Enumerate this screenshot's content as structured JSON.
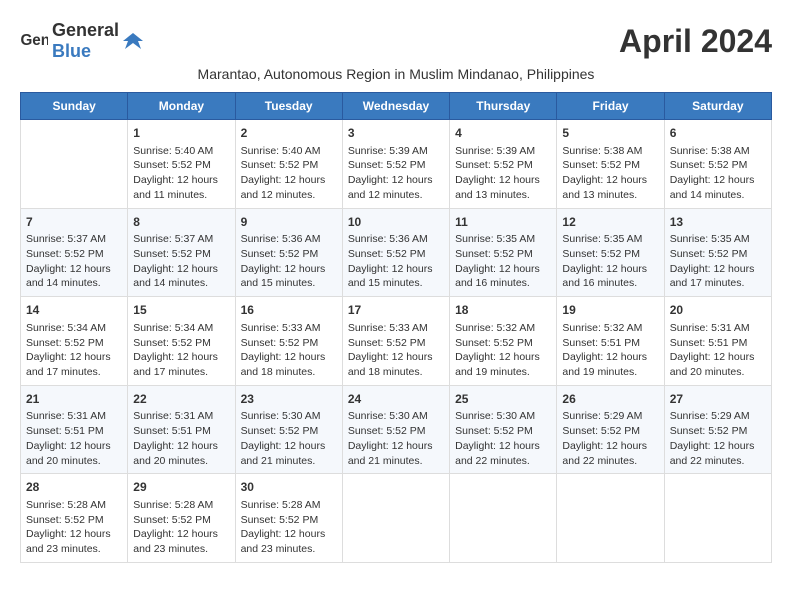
{
  "logo": {
    "text_general": "General",
    "text_blue": "Blue"
  },
  "title": "April 2024",
  "subtitle": "Marantao, Autonomous Region in Muslim Mindanao, Philippines",
  "days_of_week": [
    "Sunday",
    "Monday",
    "Tuesday",
    "Wednesday",
    "Thursday",
    "Friday",
    "Saturday"
  ],
  "weeks": [
    [
      {
        "day": "",
        "info": ""
      },
      {
        "day": "1",
        "info": "Sunrise: 5:40 AM\nSunset: 5:52 PM\nDaylight: 12 hours\nand 11 minutes."
      },
      {
        "day": "2",
        "info": "Sunrise: 5:40 AM\nSunset: 5:52 PM\nDaylight: 12 hours\nand 12 minutes."
      },
      {
        "day": "3",
        "info": "Sunrise: 5:39 AM\nSunset: 5:52 PM\nDaylight: 12 hours\nand 12 minutes."
      },
      {
        "day": "4",
        "info": "Sunrise: 5:39 AM\nSunset: 5:52 PM\nDaylight: 12 hours\nand 13 minutes."
      },
      {
        "day": "5",
        "info": "Sunrise: 5:38 AM\nSunset: 5:52 PM\nDaylight: 12 hours\nand 13 minutes."
      },
      {
        "day": "6",
        "info": "Sunrise: 5:38 AM\nSunset: 5:52 PM\nDaylight: 12 hours\nand 14 minutes."
      }
    ],
    [
      {
        "day": "7",
        "info": "Sunrise: 5:37 AM\nSunset: 5:52 PM\nDaylight: 12 hours\nand 14 minutes."
      },
      {
        "day": "8",
        "info": "Sunrise: 5:37 AM\nSunset: 5:52 PM\nDaylight: 12 hours\nand 14 minutes."
      },
      {
        "day": "9",
        "info": "Sunrise: 5:36 AM\nSunset: 5:52 PM\nDaylight: 12 hours\nand 15 minutes."
      },
      {
        "day": "10",
        "info": "Sunrise: 5:36 AM\nSunset: 5:52 PM\nDaylight: 12 hours\nand 15 minutes."
      },
      {
        "day": "11",
        "info": "Sunrise: 5:35 AM\nSunset: 5:52 PM\nDaylight: 12 hours\nand 16 minutes."
      },
      {
        "day": "12",
        "info": "Sunrise: 5:35 AM\nSunset: 5:52 PM\nDaylight: 12 hours\nand 16 minutes."
      },
      {
        "day": "13",
        "info": "Sunrise: 5:35 AM\nSunset: 5:52 PM\nDaylight: 12 hours\nand 17 minutes."
      }
    ],
    [
      {
        "day": "14",
        "info": "Sunrise: 5:34 AM\nSunset: 5:52 PM\nDaylight: 12 hours\nand 17 minutes."
      },
      {
        "day": "15",
        "info": "Sunrise: 5:34 AM\nSunset: 5:52 PM\nDaylight: 12 hours\nand 17 minutes."
      },
      {
        "day": "16",
        "info": "Sunrise: 5:33 AM\nSunset: 5:52 PM\nDaylight: 12 hours\nand 18 minutes."
      },
      {
        "day": "17",
        "info": "Sunrise: 5:33 AM\nSunset: 5:52 PM\nDaylight: 12 hours\nand 18 minutes."
      },
      {
        "day": "18",
        "info": "Sunrise: 5:32 AM\nSunset: 5:52 PM\nDaylight: 12 hours\nand 19 minutes."
      },
      {
        "day": "19",
        "info": "Sunrise: 5:32 AM\nSunset: 5:51 PM\nDaylight: 12 hours\nand 19 minutes."
      },
      {
        "day": "20",
        "info": "Sunrise: 5:31 AM\nSunset: 5:51 PM\nDaylight: 12 hours\nand 20 minutes."
      }
    ],
    [
      {
        "day": "21",
        "info": "Sunrise: 5:31 AM\nSunset: 5:51 PM\nDaylight: 12 hours\nand 20 minutes."
      },
      {
        "day": "22",
        "info": "Sunrise: 5:31 AM\nSunset: 5:51 PM\nDaylight: 12 hours\nand 20 minutes."
      },
      {
        "day": "23",
        "info": "Sunrise: 5:30 AM\nSunset: 5:52 PM\nDaylight: 12 hours\nand 21 minutes."
      },
      {
        "day": "24",
        "info": "Sunrise: 5:30 AM\nSunset: 5:52 PM\nDaylight: 12 hours\nand 21 minutes."
      },
      {
        "day": "25",
        "info": "Sunrise: 5:30 AM\nSunset: 5:52 PM\nDaylight: 12 hours\nand 22 minutes."
      },
      {
        "day": "26",
        "info": "Sunrise: 5:29 AM\nSunset: 5:52 PM\nDaylight: 12 hours\nand 22 minutes."
      },
      {
        "day": "27",
        "info": "Sunrise: 5:29 AM\nSunset: 5:52 PM\nDaylight: 12 hours\nand 22 minutes."
      }
    ],
    [
      {
        "day": "28",
        "info": "Sunrise: 5:28 AM\nSunset: 5:52 PM\nDaylight: 12 hours\nand 23 minutes."
      },
      {
        "day": "29",
        "info": "Sunrise: 5:28 AM\nSunset: 5:52 PM\nDaylight: 12 hours\nand 23 minutes."
      },
      {
        "day": "30",
        "info": "Sunrise: 5:28 AM\nSunset: 5:52 PM\nDaylight: 12 hours\nand 23 minutes."
      },
      {
        "day": "",
        "info": ""
      },
      {
        "day": "",
        "info": ""
      },
      {
        "day": "",
        "info": ""
      },
      {
        "day": "",
        "info": ""
      }
    ]
  ]
}
